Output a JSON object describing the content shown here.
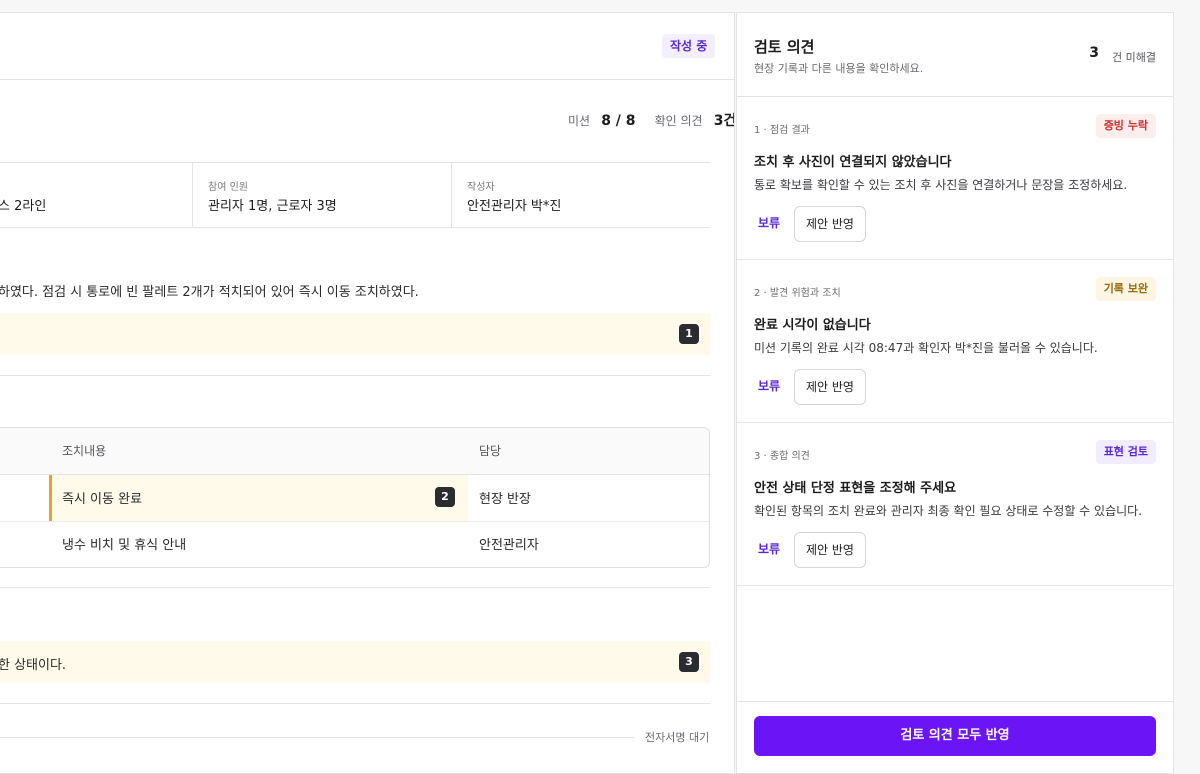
{
  "document": {
    "status_badge": "작성 중",
    "stats": {
      "mission_label": "미션",
      "mission_value": "8 / 8",
      "opinion_label": "확인 의견",
      "opinion_value": "3건"
    },
    "meta": [
      {
        "label": "",
        "value": "스 2라인"
      },
      {
        "label": "참여 인원",
        "value": "관리자 1명, 근로자 3명"
      },
      {
        "label": "작성자",
        "value": "안전관리자 박*진"
      }
    ],
    "paragraph1": "하였다. 점검 시 통로에 빈 팔레트 2개가 적치되어 있어 즉시 이동 조치하였다.",
    "marker1": "1",
    "table": {
      "headers": [
        "조치내용",
        "담당"
      ],
      "rows": [
        {
          "action": "즉시 이동 완료",
          "owner": "현장 반장",
          "marker": "2"
        },
        {
          "action": "냉수 비치 및 휴식 안내",
          "owner": "안전관리자"
        }
      ]
    },
    "paragraph3": "한 상태이다.",
    "marker3": "3",
    "signature_status": "전자서명 대기"
  },
  "panel": {
    "title": "검토 의견",
    "subtitle": "현장 기록과 다른 내용을 확인하세요.",
    "unresolved_count": "3",
    "unresolved_suffix": "건 미해결",
    "cards": [
      {
        "meta": "1 · 점검 결과",
        "badge": "증빙 누락",
        "title": "조치 후 사진이 연결되지 않았습니다",
        "desc": "통로 확보를 확인할 수 있는 조치 후 사진을 연결하거나 문장을 조정하세요.",
        "hold": "보류",
        "apply": "제안 반영"
      },
      {
        "meta": "2 · 발견 위험과 조치",
        "badge": "기록 보완",
        "title": "완료 시각이 없습니다",
        "desc": "미션 기록의 완료 시각 08:47과 확인자 박*진을 불러올 수 있습니다.",
        "hold": "보류",
        "apply": "제안 반영"
      },
      {
        "meta": "3 · 종합 의견",
        "badge": "표현 검토",
        "title": "안전 상태 단정 표현을 조정해 주세요",
        "desc": "확인된 항목의 조치 완료와 관리자 최종 확인 필요 상태로 수정할 수 있습니다.",
        "hold": "보류",
        "apply": "제안 반영"
      }
    ],
    "apply_all": "검토 의견 모두 반영"
  },
  "colors": {
    "accent": "#6b14f5",
    "badge_missing_bg": "#fdeeee",
    "badge_missing_fg": "#c8312b",
    "badge_record_bg": "#fdf6e3",
    "badge_record_fg": "#9a6a0a",
    "badge_expr_bg": "#f1ecfe",
    "badge_expr_fg": "#5b2ad6",
    "highlight": "#fffaea"
  }
}
